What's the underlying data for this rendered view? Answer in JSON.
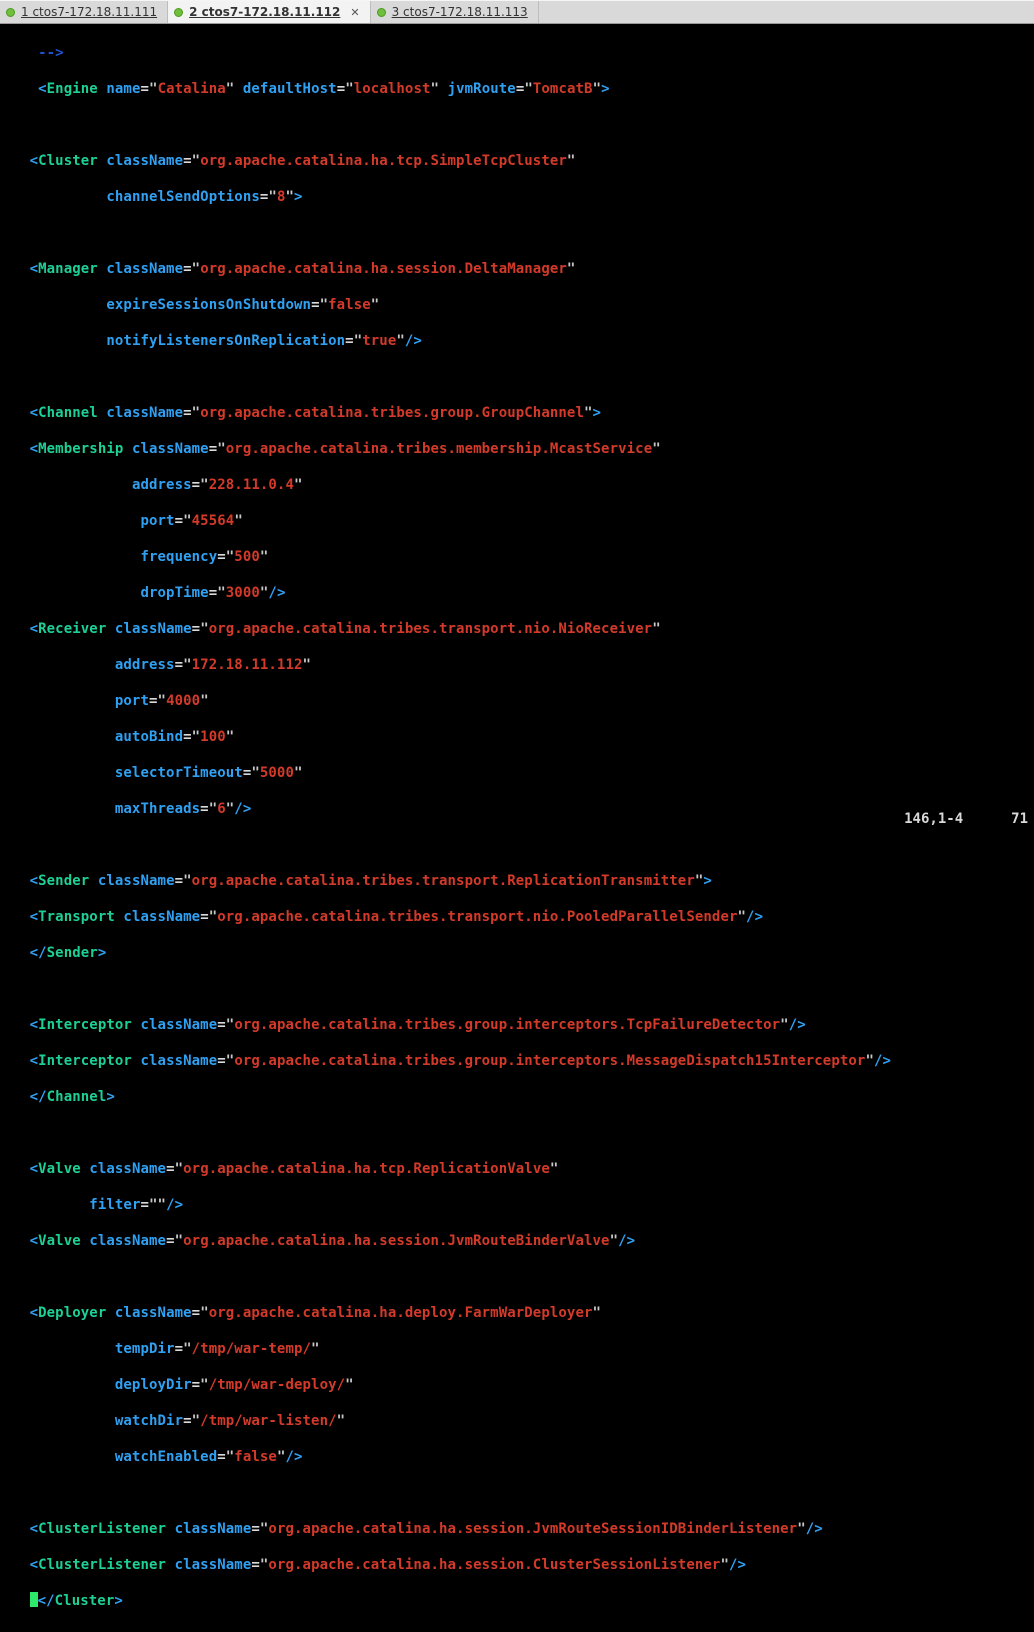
{
  "tabs": [
    {
      "label": "1 ctos7-172.18.11.111",
      "active": false
    },
    {
      "label": "2 ctos7-172.18.11.112",
      "active": true
    },
    {
      "label": "3 ctos7-172.18.11.113",
      "active": false
    }
  ],
  "status": {
    "left": "",
    "pos": "146,1-4",
    "pct": "71"
  },
  "code": {
    "comment_tail": "-->",
    "engine": {
      "tag": "Engine",
      "name": "Catalina",
      "defaultHost": "localhost",
      "jvmRoute": "TomcatB"
    },
    "cluster": {
      "tag": "Cluster",
      "className": "org.apache.catalina.ha.tcp.SimpleTcpCluster",
      "channelSendOptions": "8"
    },
    "manager": {
      "tag": "Manager",
      "className": "org.apache.catalina.ha.session.DeltaManager",
      "expireSessionsOnShutdown": "false",
      "notifyListenersOnReplication": "true"
    },
    "channel": {
      "tag": "Channel",
      "className": "org.apache.catalina.tribes.group.GroupChannel"
    },
    "membership": {
      "tag": "Membership",
      "className": "org.apache.catalina.tribes.membership.McastService",
      "address": "228.11.0.4",
      "port": "45564",
      "frequency": "500",
      "dropTime": "3000"
    },
    "receiver": {
      "tag": "Receiver",
      "className": "org.apache.catalina.tribes.transport.nio.NioReceiver",
      "address": "172.18.11.112",
      "port": "4000",
      "autoBind": "100",
      "selectorTimeout": "5000",
      "maxThreads": "6"
    },
    "sender": {
      "tag": "Sender",
      "className": "org.apache.catalina.tribes.transport.ReplicationTransmitter"
    },
    "transport": {
      "tag": "Transport",
      "className": "org.apache.catalina.tribes.transport.nio.PooledParallelSender"
    },
    "senderClose": "Sender",
    "interceptor1": {
      "tag": "Interceptor",
      "className": "org.apache.catalina.tribes.group.interceptors.TcpFailureDetector"
    },
    "interceptor2": {
      "tag": "Interceptor",
      "className": "org.apache.catalina.tribes.group.interceptors.MessageDispatch15Interceptor"
    },
    "channelClose": "Channel",
    "valve1": {
      "tag": "Valve",
      "className": "org.apache.catalina.ha.tcp.ReplicationValve",
      "filter": ""
    },
    "valve2": {
      "tag": "Valve",
      "className": "org.apache.catalina.ha.session.JvmRouteBinderValve"
    },
    "deployer": {
      "tag": "Deployer",
      "className": "org.apache.catalina.ha.deploy.FarmWarDeployer",
      "tempDir": "/tmp/war-temp/",
      "deployDir": "/tmp/war-deploy/",
      "watchDir": "/tmp/war-listen/",
      "watchEnabled": "false"
    },
    "clusterListener1": {
      "tag": "ClusterListener",
      "className": "org.apache.catalina.ha.session.JvmRouteSessionIDBinderListener"
    },
    "clusterListener2": {
      "tag": "ClusterListener",
      "className": "org.apache.catalina.ha.session.ClusterSessionListener"
    },
    "clusterClose": "Cluster"
  }
}
